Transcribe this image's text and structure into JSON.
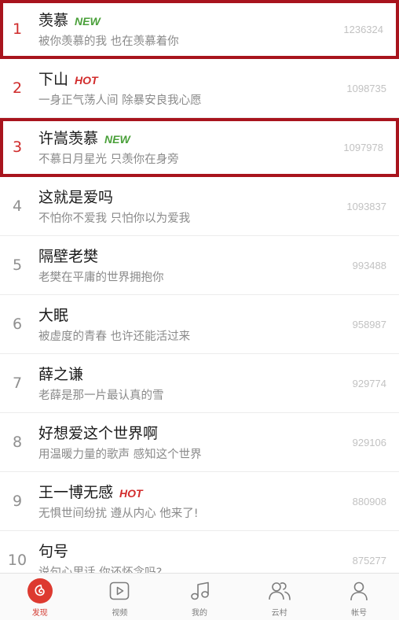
{
  "songs": [
    {
      "rank": "1",
      "title": "羡慕",
      "badge": "NEW",
      "subtitle": "被你羡慕的我 也在羡慕着你",
      "count": "1236324"
    },
    {
      "rank": "2",
      "title": "下山",
      "badge": "HOT",
      "subtitle": "一身正气荡人间 除暴安良我心愿",
      "count": "1098735"
    },
    {
      "rank": "3",
      "title": "许嵩羡慕",
      "badge": "NEW",
      "subtitle": "不慕日月星光 只羡你在身旁",
      "count": "1097978"
    },
    {
      "rank": "4",
      "title": "这就是爱吗",
      "badge": "",
      "subtitle": "不怕你不爱我 只怕你以为爱我",
      "count": "1093837"
    },
    {
      "rank": "5",
      "title": "隔壁老樊",
      "badge": "",
      "subtitle": "老樊在平庸的世界拥抱你",
      "count": "993488"
    },
    {
      "rank": "6",
      "title": "大眠",
      "badge": "",
      "subtitle": "被虚度的青春 也许还能活过来",
      "count": "958987"
    },
    {
      "rank": "7",
      "title": "薛之谦",
      "badge": "",
      "subtitle": "老薛是那一片最认真的雪",
      "count": "929774"
    },
    {
      "rank": "8",
      "title": "好想爱这个世界啊",
      "badge": "",
      "subtitle": "用温暖力量的歌声 感知这个世界",
      "count": "929106"
    },
    {
      "rank": "9",
      "title": "王一博无感",
      "badge": "HOT",
      "subtitle": "无惧世间纷扰 遵从内心 他来了!",
      "count": "880908"
    },
    {
      "rank": "10",
      "title": "句号",
      "badge": "",
      "subtitle": "说句心里话 你还怀念吗?",
      "count": "875277"
    }
  ],
  "tabs": [
    {
      "label": "发现",
      "icon": "discover-icon",
      "active": true
    },
    {
      "label": "视频",
      "icon": "video-icon"
    },
    {
      "label": "我的",
      "icon": "music-note-icon"
    },
    {
      "label": "云村",
      "icon": "community-icon"
    },
    {
      "label": "帐号",
      "icon": "account-icon"
    }
  ],
  "colors": {
    "accent": "#dd3a30",
    "new_badge": "#4aa03a",
    "hot_badge": "#d22c2c",
    "highlight_border": "#a8141d"
  }
}
